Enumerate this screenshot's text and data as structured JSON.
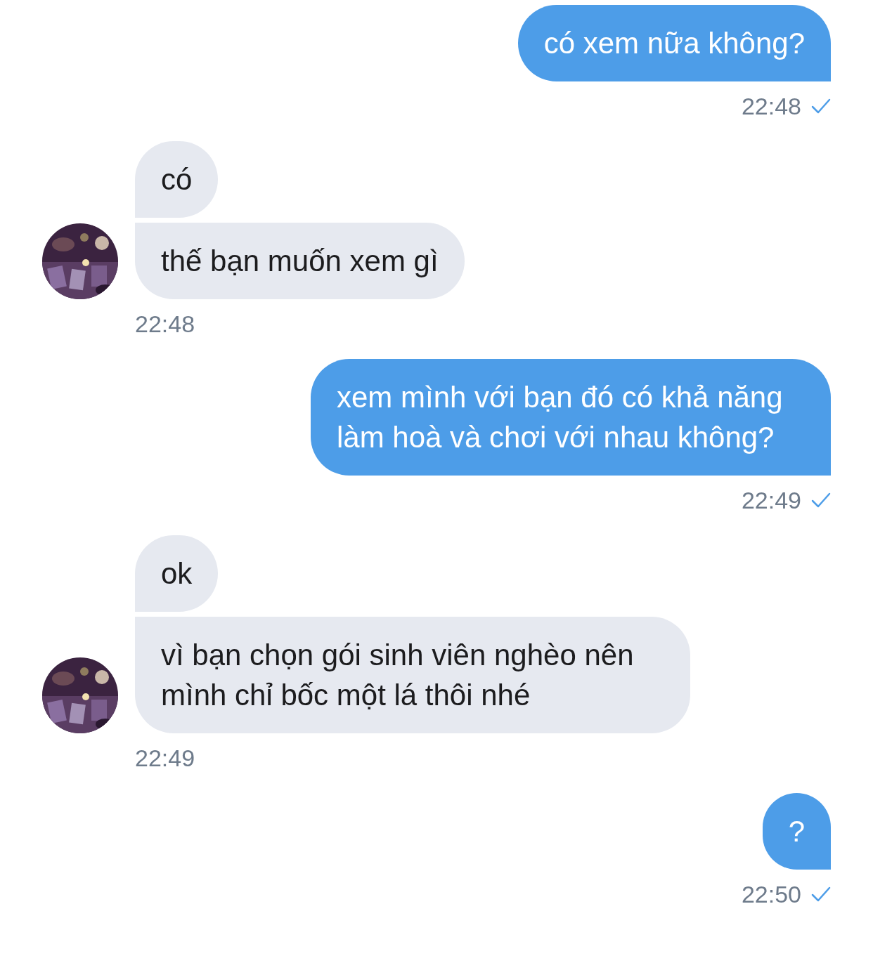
{
  "messages": [
    {
      "kind": "sent",
      "bubbles": [
        "có xem nữa không?"
      ],
      "time": "22:48",
      "read": true
    },
    {
      "kind": "received",
      "bubbles": [
        "có",
        "thế bạn muốn xem gì"
      ],
      "time": "22:48"
    },
    {
      "kind": "sent",
      "bubbles": [
        "xem mình với bạn đó có khả năng làm hoà và chơi với nhau không?"
      ],
      "time": "22:49",
      "read": true
    },
    {
      "kind": "received",
      "bubbles": [
        "ok",
        "vì bạn chọn gói sinh viên nghèo nên mình chỉ bốc một lá thôi nhé"
      ],
      "time": "22:49"
    },
    {
      "kind": "sent",
      "bubbles": [
        "?"
      ],
      "time": "22:50",
      "read": true
    }
  ]
}
